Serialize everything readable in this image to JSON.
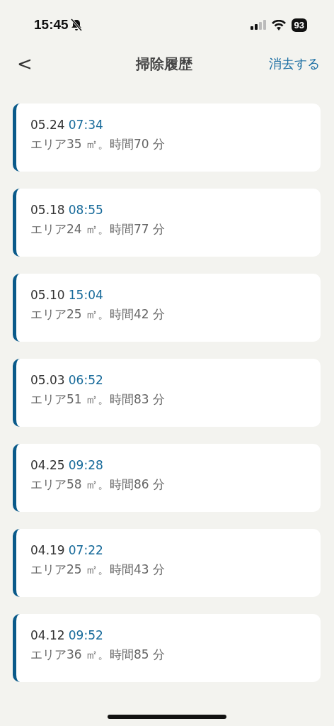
{
  "status_bar": {
    "time": "15:45",
    "battery": "93"
  },
  "nav": {
    "back": "<",
    "title": "掃除履歴",
    "action": "消去する"
  },
  "records": [
    {
      "date": "05.24",
      "time": "07:34",
      "summary": "エリア35 ㎡。時間70 分"
    },
    {
      "date": "05.18",
      "time": "08:55",
      "summary": "エリア24 ㎡。時間77 分"
    },
    {
      "date": "05.10",
      "time": "15:04",
      "summary": "エリア25 ㎡。時間42 分"
    },
    {
      "date": "05.03",
      "time": "06:52",
      "summary": "エリア51 ㎡。時間83 分"
    },
    {
      "date": "04.25",
      "time": "09:28",
      "summary": "エリア58 ㎡。時間86 分"
    },
    {
      "date": "04.19",
      "time": "07:22",
      "summary": "エリア25 ㎡。時間43 分"
    },
    {
      "date": "04.12",
      "time": "09:52",
      "summary": "エリア36 ㎡。時間85 分"
    }
  ]
}
